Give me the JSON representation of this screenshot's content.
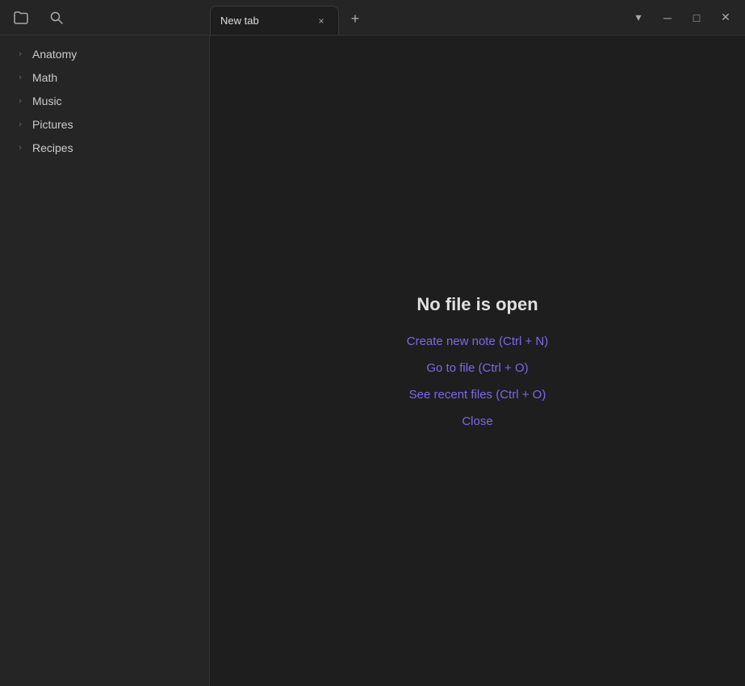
{
  "titleBar": {
    "folderIconLabel": "folder-icon",
    "searchIconLabel": "search-icon"
  },
  "tab": {
    "label": "New tab",
    "closeLabel": "×",
    "addLabel": "+"
  },
  "windowControls": {
    "dropdown": "▾",
    "minimize": "─",
    "maximize": "□",
    "close": "✕"
  },
  "sidebar": {
    "items": [
      {
        "label": "Anatomy"
      },
      {
        "label": "Math"
      },
      {
        "label": "Music"
      },
      {
        "label": "Pictures"
      },
      {
        "label": "Recipes"
      }
    ]
  },
  "content": {
    "noFileTitle": "No file is open",
    "createNewNote": "Create new note (Ctrl + N)",
    "goToFile": "Go to file (Ctrl + O)",
    "seeRecentFiles": "See recent files (Ctrl + O)",
    "close": "Close"
  }
}
